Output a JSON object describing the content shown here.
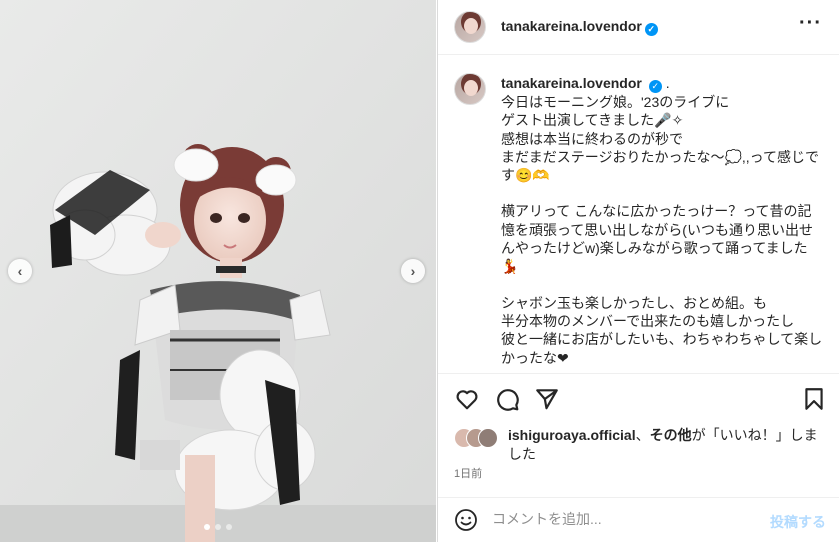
{
  "post": {
    "username": "tanakareina.lovendor",
    "more_icon": "more-horizontal-icon",
    "verified_icon": "verified-badge-icon"
  },
  "caption": {
    "username": "tanakareina.lovendor",
    "separator": ".",
    "paragraphs": [
      "今日はモーニング娘。'23のライブに\nゲスト出演してきました🎤✧\n感想は本当に終わるのが秒で\nまだまだステージおりたかったな〜💭,,って感じです😊🫶",
      "横アリって こんなに広かったっけー？って昔の記憶を頑張って思い出しながら(いつも通り思い出せんやったけどw)楽しみながら歌って踊ってました💃",
      "シャボン玉も楽しかったし、おとめ組。も\n半分本物のメンバーで出来たのも嬉しかったし\n彼と一緒にお店がしたいも、わちゃわちゃして楽しかったな❤"
    ]
  },
  "actions": {
    "like_icon": "heart-icon",
    "comment_icon": "comment-icon",
    "share_icon": "send-icon",
    "save_icon": "bookmark-icon"
  },
  "likes": {
    "user": "ishiguroaya.official",
    "sep": "、",
    "others": "その他",
    "suffix": "が「いいね！」しました"
  },
  "timestamp": "1日前",
  "comment": {
    "placeholder": "コメントを追加...",
    "post_label": "投稿する",
    "emoji_icon": "smile-icon"
  },
  "carousel": {
    "prev_icon": "chevron-left-icon",
    "next_icon": "chevron-right-icon",
    "slide_count": 3,
    "active_slide": 1
  },
  "colors": {
    "verified": "#0095f6",
    "post_button_disabled": "#b3dbff",
    "photo_background": "#e6e7e6"
  }
}
